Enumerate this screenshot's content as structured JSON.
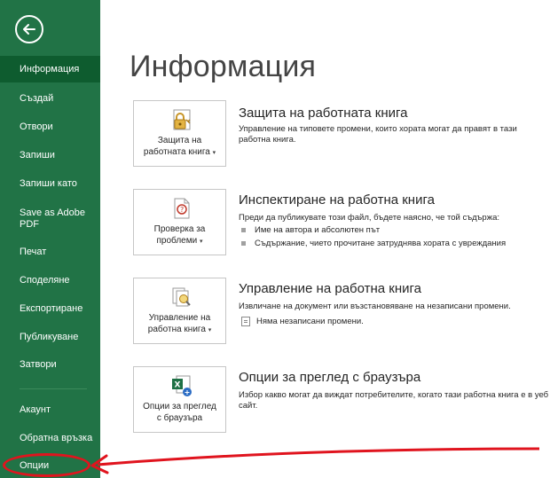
{
  "sidebar": {
    "back_icon": "arrow-left-circle-icon",
    "bg_color": "#217346",
    "items": [
      {
        "label": "Информация"
      },
      {
        "label": "Създай"
      },
      {
        "label": "Отвори"
      },
      {
        "label": "Запиши"
      },
      {
        "label": "Запиши като"
      },
      {
        "label": "Save as Adobe PDF"
      },
      {
        "label": "Печат"
      },
      {
        "label": "Споделяне"
      },
      {
        "label": "Експортиране"
      },
      {
        "label": "Публикуване"
      },
      {
        "label": "Затвори"
      },
      {
        "label": "Акаунт"
      },
      {
        "label": "Обратна връзка"
      },
      {
        "label": "Опции"
      }
    ]
  },
  "main": {
    "title": "Информация",
    "sections": [
      {
        "tile_label_1": "Защита на",
        "tile_label_2": "работната книга",
        "tile_icon": "lock-key-icon",
        "title": "Защита на работната книга",
        "description": "Управление на типовете промени, които хората могат да правят в тази работна книга."
      },
      {
        "tile_label_1": "Проверка за",
        "tile_label_2": "проблеми",
        "tile_icon": "inspect-document-icon",
        "title": "Инспектиране на работна книга",
        "description": "Преди да публикувате този файл, бъдете наясно, че той съдържа:",
        "bullets": [
          "Име на автора и абсолютен път",
          "Съдържание, чието прочитане затруднява хората с увреждания"
        ]
      },
      {
        "tile_label_1": "Управление на",
        "tile_label_2": "работна книга",
        "tile_icon": "manage-workbook-icon",
        "title": "Управление на работна книга",
        "description": "Извличане на документ или възстановяване на незаписани промени.",
        "note": "Няма незаписани промени."
      },
      {
        "tile_label_1": "Опции за преглед",
        "tile_label_2": "с браузъра",
        "tile_icon": "browser-view-options-icon",
        "title": "Опции за преглед с браузъра",
        "description": "Избор какво могат да виждат потребителите, когато тази работна книга е в уеб сайт."
      }
    ]
  },
  "annotation": {
    "color": "#e0141e",
    "target": "Опции"
  }
}
